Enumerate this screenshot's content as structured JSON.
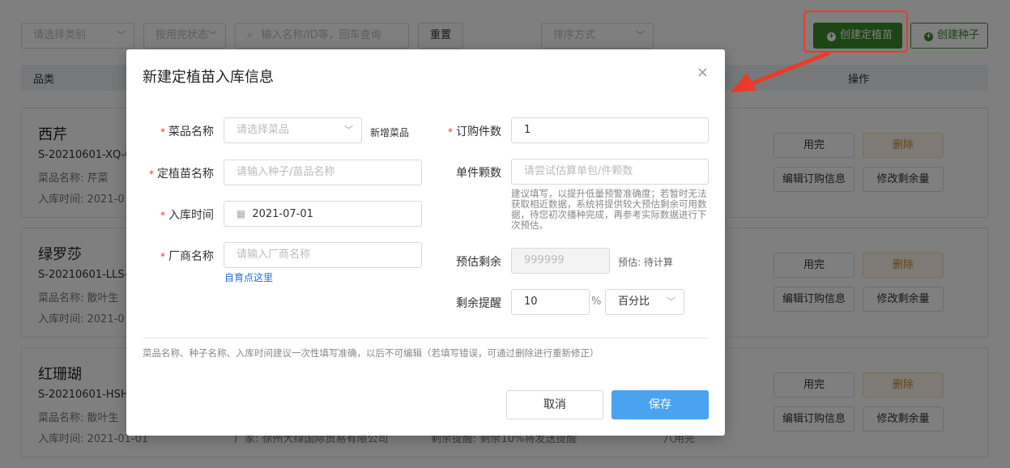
{
  "toolbar": {
    "category_placeholder": "请选择类别",
    "status_placeholder": "按用完状态",
    "search_placeholder": "输入名称/ID等，回车查询",
    "reset_label": "重置",
    "sort_placeholder": "排序方式",
    "create_seedling_label": "创建定植苗",
    "create_seed_label": "创建种子"
  },
  "table": {
    "col_category": "品类",
    "col_actions": "操作"
  },
  "cards": [
    {
      "name": "西芹",
      "code": "S-20210601-XQ-0",
      "variety": "菜品名称: 芹菜",
      "date": "入库时间: 2021-0",
      "extra1": "",
      "extra2": "",
      "extra3": ""
    },
    {
      "name": "绿罗莎",
      "code": "S-20210601-LLS-",
      "variety": "菜品名称: 散叶生",
      "date": "入库时间: 2021-0",
      "extra1": "",
      "extra2": "",
      "extra3": ""
    },
    {
      "name": "红珊瑚",
      "code": "S-20210601-HSH",
      "variety": "菜品名称: 散叶生",
      "date": "入库时间: 2021-01-01",
      "extra1": "厂家: 徐州大绿国际贸易有限公司",
      "extra2": "剩余提醒: 剩余10%将发送提醒",
      "extra3": "八用完"
    }
  ],
  "card_buttons": {
    "use": "用完",
    "delete": "删除",
    "edit": "编辑订购信息",
    "modify": "修改剩余量"
  },
  "modal": {
    "title": "新建定植苗入库信息",
    "close_glyph": "×",
    "variety_label": "菜品名称",
    "variety_placeholder": "请选择菜品",
    "add_variety_label": "新增菜品",
    "seedling_label": "定植苗名称",
    "seedling_placeholder": "请输入种子/苗品名称",
    "date_label": "入库时间",
    "date_value": "2021-07-01",
    "vendor_label": "厂商名称",
    "vendor_placeholder": "请输入厂商名称",
    "self_grow_link": "自育点这里",
    "order_qty_label": "订购件数",
    "order_qty_value": "1",
    "unit_count_label": "单件颗数",
    "unit_count_placeholder": "请尝试估算单包/件颗数",
    "unit_count_hint": "建议填写，以提升低量预警准确度；若暂时无法获取相近数据，系统将提供较大预估剩余可用数据，待您初次播种完成，再参考实际数据进行下次预估。",
    "est_remaining_label": "预估剩余",
    "est_remaining_value": "999999",
    "est_remaining_note": "预估: 待计算",
    "reminder_label": "剩余提醒",
    "reminder_value": "10",
    "reminder_unit": "%",
    "reminder_mode": "百分比",
    "footnote": "菜品名称、种子名称、入库时间建议一次性填写准确，以后不可编辑（若填写错误，可通过删除进行重新修正）",
    "cancel_label": "取消",
    "save_label": "保存"
  },
  "colors": {
    "brand_green": "#3a8a2a",
    "primary_blue": "#4aa3ef",
    "highlight_red": "#ea3b2a"
  }
}
